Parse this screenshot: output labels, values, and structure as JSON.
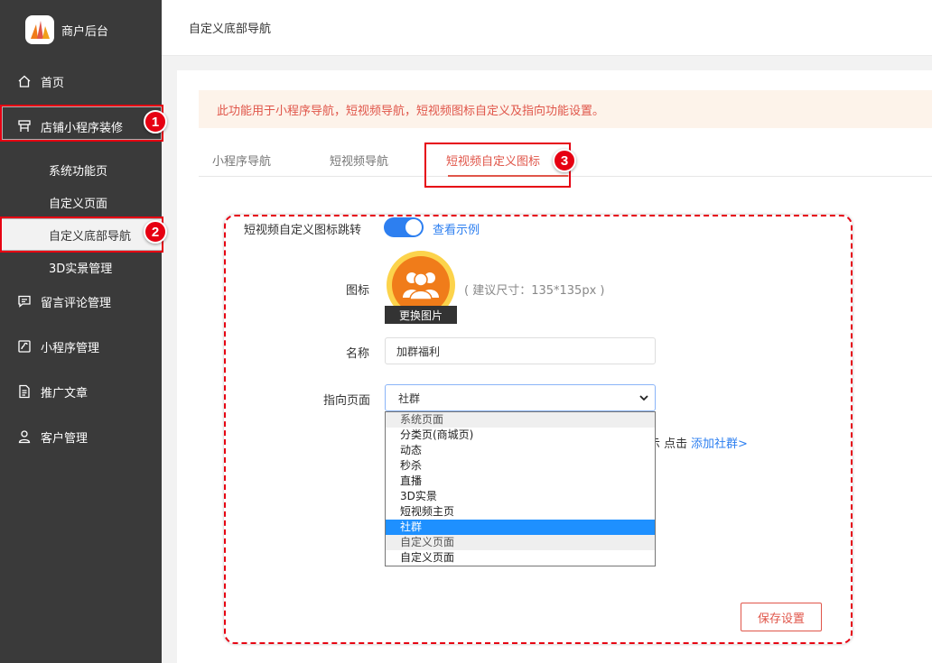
{
  "app": {
    "name": "商户后台"
  },
  "colors": {
    "sidebar_bg": "#3a3a3a",
    "accent": "#e0564a",
    "highlight": "#e60012",
    "link": "#2d7ff0"
  },
  "sidebar": {
    "items": [
      {
        "label": "首页",
        "icon": "home-icon"
      },
      {
        "label": "店铺小程序装修",
        "icon": "store-icon"
      },
      {
        "label": "留言评论管理",
        "icon": "comment-icon"
      },
      {
        "label": "小程序管理",
        "icon": "miniprogram-icon"
      },
      {
        "label": "推广文章",
        "icon": "article-icon"
      },
      {
        "label": "客户管理",
        "icon": "user-icon"
      }
    ],
    "sub_items": [
      {
        "label": "系统功能页"
      },
      {
        "label": "自定义页面"
      },
      {
        "label": "自定义底部导航",
        "active": true
      },
      {
        "label": "3D实景管理"
      }
    ]
  },
  "header": {
    "title": "自定义底部导航"
  },
  "notice": "此功能用于小程序导航，短视频导航，短视频图标自定义及指向功能设置。",
  "tabs": [
    {
      "label": "小程序导航"
    },
    {
      "label": "短视频导航"
    },
    {
      "label": "短视频自定义图标",
      "active": true
    }
  ],
  "form": {
    "jump_label": "短视频自定义图标跳转",
    "jump_enabled": true,
    "view_example": "查看示例",
    "icon_label": "图标",
    "change_image": "更换图片",
    "size_hint": "( 建议尺寸：135*135px )",
    "name_label": "名称",
    "name_value": "加群福利",
    "target_label": "指向页面",
    "target_value": "社群",
    "target_options": [
      {
        "label": "系统页面",
        "group": true
      },
      {
        "label": "分类页(商城页)"
      },
      {
        "label": "动态"
      },
      {
        "label": "秒杀"
      },
      {
        "label": "直播"
      },
      {
        "label": "3D实景"
      },
      {
        "label": "短视频主页"
      },
      {
        "label": "社群",
        "selected": true
      },
      {
        "label": "自定义页面",
        "group": true
      },
      {
        "label": "自定义页面"
      }
    ],
    "behind_text": "示 点击",
    "add_group_link": "添加社群>",
    "save_label": "保存设置"
  },
  "annotations": [
    "1",
    "2",
    "3"
  ]
}
